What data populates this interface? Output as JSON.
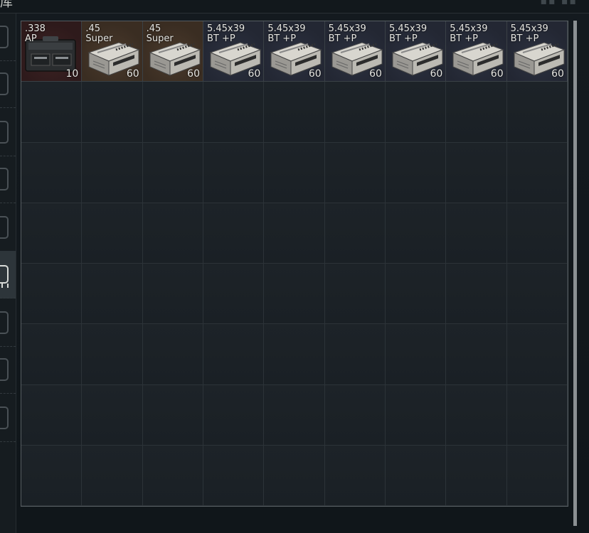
{
  "header": {
    "title": "库"
  },
  "sidebar": {
    "tabs": [
      {
        "name": "tab-1",
        "active": false
      },
      {
        "name": "tab-2",
        "active": false
      },
      {
        "name": "tab-3",
        "active": false
      },
      {
        "name": "tab-4",
        "active": false
      },
      {
        "name": "tab-5",
        "active": false
      },
      {
        "name": "tab-6",
        "active": true
      },
      {
        "name": "tab-7",
        "active": false
      },
      {
        "name": "tab-8",
        "active": false
      },
      {
        "name": "tab-9",
        "active": false
      }
    ]
  },
  "stash": {
    "columns": 9,
    "rows": 8,
    "items": [
      {
        "name": ".338\nAP",
        "count": "10",
        "tint": "red",
        "icon": "ammo-crate-icon"
      },
      {
        "name": ".45\nSuper",
        "count": "60",
        "tint": "brown",
        "icon": "ammo-box-icon"
      },
      {
        "name": ".45\nSuper",
        "count": "60",
        "tint": "brown",
        "icon": "ammo-box-icon"
      },
      {
        "name": "5.45x39\nBT +P",
        "count": "60",
        "tint": "blue",
        "icon": "ammo-box-icon"
      },
      {
        "name": "5.45x39\nBT +P",
        "count": "60",
        "tint": "blue",
        "icon": "ammo-box-icon"
      },
      {
        "name": "5.45x39\nBT +P",
        "count": "60",
        "tint": "blue",
        "icon": "ammo-box-icon"
      },
      {
        "name": "5.45x39\nBT +P",
        "count": "60",
        "tint": "blue",
        "icon": "ammo-box-icon"
      },
      {
        "name": "5.45x39\nBT +P",
        "count": "60",
        "tint": "blue",
        "icon": "ammo-box-icon"
      },
      {
        "name": "5.45x39\nBT +P",
        "count": "60",
        "tint": "blue",
        "icon": "ammo-box-icon"
      }
    ]
  },
  "colors": {
    "grid_line": "#2c3338",
    "border": "#565d61",
    "text": "#e6e6e2",
    "red_tint": "#3c2223",
    "brown_tint": "#4a3a2c",
    "blue_tint": "#2c3140"
  }
}
